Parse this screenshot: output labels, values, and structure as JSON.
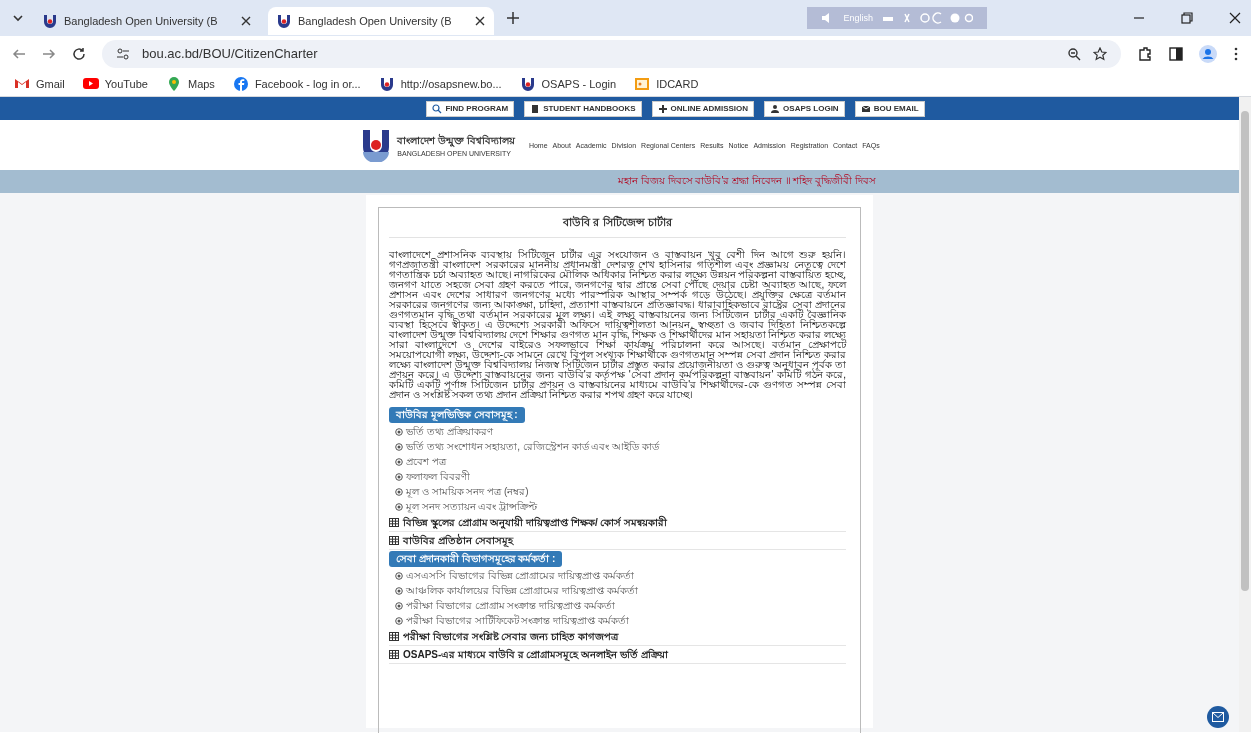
{
  "browser": {
    "tabs": [
      {
        "title": "Bangladesh Open University (B",
        "selected": false
      },
      {
        "title": "Bangladesh Open University (B",
        "selected": true
      }
    ],
    "url": "bou.ac.bd/BOU/CitizenCharter",
    "language": "English",
    "bookmarks": [
      {
        "label": "Gmail",
        "kind": "gmail"
      },
      {
        "label": "YouTube",
        "kind": "youtube"
      },
      {
        "label": "Maps",
        "kind": "maps"
      },
      {
        "label": "Facebook - log in or...",
        "kind": "facebook"
      },
      {
        "label": "http://osapsnew.bo...",
        "kind": "site"
      },
      {
        "label": "OSAPS - Login",
        "kind": "site"
      },
      {
        "label": "IDCARD",
        "kind": "idcard"
      }
    ]
  },
  "page": {
    "top_links": [
      "FIND PROGRAM",
      "STUDENT HANDBOOKS",
      "ONLINE ADMISSION",
      "OSAPS LOGIN",
      "BOU EMAIL"
    ],
    "logo": {
      "name_bn": "বাংলাদেশ উন্মুক্ত বিশ্ববিদ্যালয়",
      "name_en": "BANGLADESH OPEN UNIVERSITY"
    },
    "nav": [
      "Home",
      "About",
      "Academic",
      "Division",
      "Regional Centers",
      "Results",
      "Notice",
      "Admission",
      "Registration",
      "Contact",
      "FAQs"
    ],
    "marquee": "মহান বিজয় দিবসে বাউবি'র শ্রদ্ধা নিবেদন  ॥  শহিদ বুদ্ধিজীবী দিবস",
    "charter": {
      "title": "বাউবি র সিটিজেন্স চার্টার",
      "intro": "বাংলাদেশে প্রশাসনিক ব্যবস্থায় সিটিজেন চার্টার এর সংযোজন ও বাস্তবায়ন খুব বেশী দিন আগে শুরু হয়নি। গণপ্রজাতন্ত্রী বাংলাদেশ সরকারের মাননীয় প্রধানমন্ত্রী দেশরত্ন শেখ হাসিনার গতিশীল এবং প্রজ্ঞাময় নেতৃত্বে দেশে গণতান্ত্রিক চর্চা অব্যাহত আছে। নাগরিকের মৌলিক অধিকার নিশ্চিত করার লক্ষ্যে উন্নয়ন পরিকল্পনা বাস্তবায়িত হচ্ছে, জনগণ যাতে সহজে সেবা গ্রহণ করতে পারে, জনগণের দ্বার প্রান্তে সেবা পৌঁছে দেয়ার চেষ্টা অব্যাহত আছে, ফলে প্রশাসন এবং দেশের সাধারণ জনগণের মধ্যে পারস্পরিক আস্থার সম্পর্ক গড়ে উঠেছে। প্রযুক্তির ক্ষেত্রে বর্তমান সরকারের জনগণের জন্য আকাঙ্ক্ষা, চাহিদা, প্রত্যাশা বাস্তবায়নে প্রতিজ্ঞাবদ্ধ। ধারাবাহিকভাবে রাষ্ট্রের সেবা প্রদানের গুণগতমান বৃদ্ধি তথা বর্তমান সরকারের মূল লক্ষ্য। এই লক্ষ্য বাস্তবায়নের জন্য সিটিজেন চার্টার একটি বৈজ্ঞানিক ব্যবস্থা হিসেবে স্বীকৃত। এ উদ্দেশ্যে সরকারী অফিসে দায়িত্বশীলতা আনয়ন, স্বচ্ছতা ও জবাব দিহিতা নিশ্চিতকল্পে বাংলাদেশ উন্মুক্ত বিশ্ববিদ্যালয় দেশে শিক্ষার গুণগত মান বৃদ্ধি, শিক্ষক ও শিক্ষার্থীদের মান সহায়তা নিশ্চিত করার লক্ষ্যে সারা বাংলাদেশে ও দেশের বাইরেও সফলভাবে শিক্ষা কার্যক্রম পরিচালনা করে আসছে। বর্তমান প্রেক্ষাপটে সময়োপযোগী লক্ষ্য, উদ্দেশ্য-কে সামনে রেখে বিপুল সংখ্যক শিক্ষার্থীকে গুণগতমান সম্পন্ন সেবা প্রদান নিশ্চিত করার লক্ষ্যে বাংলাদেশ উন্মুক্ত বিশ্ববিদ্যালয় নিজস্ব সিটিজেন চার্টার প্রস্তুত করার প্রয়োজনীয়তা ও গুরুত্ব অনুধাবন পূর্বক তা প্রণয়ন করে। এ উদ্দেশ্য বাস্তবায়নের জন্য বাউবি'র কর্তৃপক্ষ 'সেবা প্রদান কর্মপরিকল্পনা বাস্তবায়ন' কমিটি গঠন করে, কমিটি একটি পূর্ণাঙ্গ সিটিজেন চার্টার প্রণয়ন ও বাস্তবায়নের মাধ্যমে বাউবি'র শিক্ষার্থীদের-কে গুণগত সম্পন্ন সেবা প্রদান ও সংশ্লিষ্ট সকল তথ্য প্রদান প্রক্রিয়া নিশ্চিত করার শপথ গ্রহণ করে যাচ্ছে।",
      "blocks": [
        {
          "kind": "header",
          "text": "বাউবির মূলভিত্তিক সেবাসমূহ :"
        },
        {
          "kind": "item",
          "text": "ভর্তি তথ্য প্রক্রিয়াকরণ"
        },
        {
          "kind": "item",
          "text": "ভর্তি তথ্য সংশোধন সহায়তা, রেজিস্ট্রেশন কার্ড এবং আইডি কার্ড"
        },
        {
          "kind": "item",
          "text": "প্রবেশ পত্র"
        },
        {
          "kind": "item",
          "text": "ফলাফল বিবরণী"
        },
        {
          "kind": "item",
          "text": "মূল ও সাময়িক সনদ পত্র (নম্বর)"
        },
        {
          "kind": "item",
          "text": "মূল সনদ সত্যায়ন এবং ট্রান্সক্রিপ্ট"
        },
        {
          "kind": "link",
          "text": "বিভিন্ন স্কুলের প্রোগ্রাম অনুযায়ী দায়িত্বপ্রাপ্ত শিক্ষক/ কোর্স সমন্বয়কারী"
        },
        {
          "kind": "link",
          "text": "বাউবির প্রতিষ্ঠান সেবাসমূহ"
        },
        {
          "kind": "header",
          "text": "সেবা প্রদানকারী বিভাগসমূহের কর্মকর্তা :"
        },
        {
          "kind": "item",
          "text": "এসএসসি বিভাগের বিভিন্ন প্রোগ্রামের দায়িত্বপ্রাপ্ত কর্মকর্তা"
        },
        {
          "kind": "item",
          "text": "আঞ্চলিক কার্যালয়ের বিভিন্ন প্রোগ্রামের দায়িত্বপ্রাপ্ত কর্মকর্তা"
        },
        {
          "kind": "item",
          "text": "পরীক্ষা বিভাগের প্রোগ্রাম সংক্রান্ত দায়িত্বপ্রাপ্ত কর্মকর্তা"
        },
        {
          "kind": "item",
          "text": "পরীক্ষা বিভাগের সার্টিফিকেট সংক্রান্ত দায়িত্বপ্রাপ্ত কর্মকর্তা"
        },
        {
          "kind": "link",
          "text": "পরীক্ষা বিভাগের সংশ্লিষ্ট সেবার জন্য চাহিত কাগজপত্র"
        },
        {
          "kind": "link",
          "text": "OSAPS-এর মাধ্যমে বাউবি র প্রোগ্রামসমূহে অনলাইন ভর্তি প্রক্রিয়া"
        }
      ]
    }
  }
}
